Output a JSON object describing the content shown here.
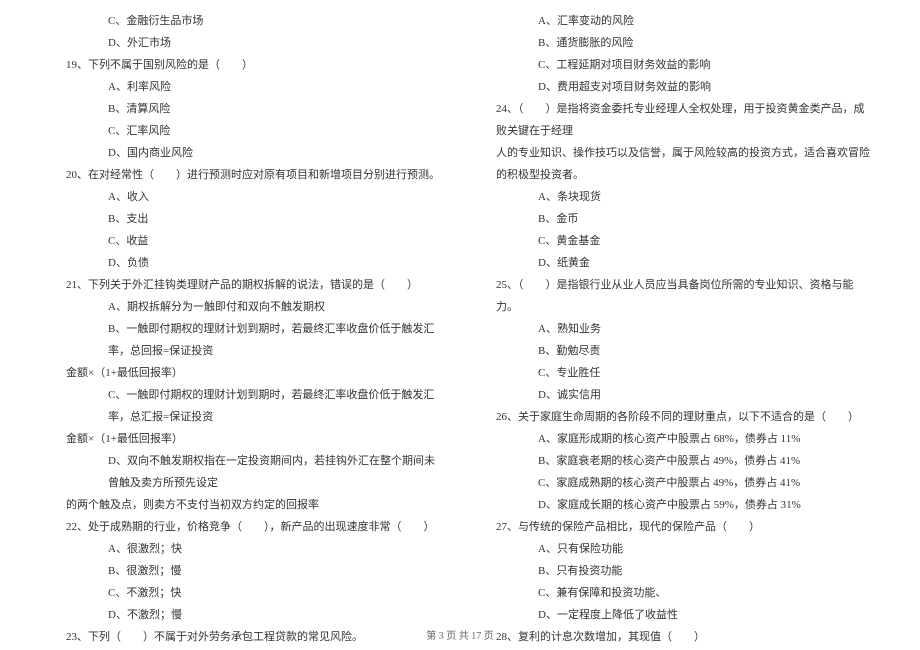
{
  "footer": "第 3 页  共 17 页",
  "left": {
    "pre_opts": [
      "C、金融衍生品市场",
      "D、外汇市场"
    ],
    "q19": {
      "text": "19、下列不属于国别风险的是（　　）",
      "opts": [
        "A、利率风险",
        "B、清算风险",
        "C、汇率风险",
        "D、国内商业风险"
      ]
    },
    "q20": {
      "text": "20、在对经常性（　　）进行预测时应对原有项目和新增项目分别进行预测。",
      "opts": [
        "A、收入",
        "B、支出",
        "C、收益",
        "D、负债"
      ]
    },
    "q21": {
      "text": "21、下列关于外汇挂钩类理财产品的期权拆解的说法，错误的是（　　）",
      "optA": "A、期权拆解分为一触即付和双向不触发期权",
      "optB1": "B、一触即付期权的理财计划到期时，若最终汇率收盘价低于触发汇率，总回报=保证投资",
      "optB2": "金额×（1+最低回报率）",
      "optC1": "C、一触即付期权的理财计划到期时，若最终汇率收盘价低于触发汇率，总汇报=保证投资",
      "optC2": "金额×（1+最低回报率）",
      "optD1": "D、双向不触发期权指在一定投资期间内，若挂钩外汇在整个期间未曾触及卖方所预先设定",
      "optD2": "的两个触及点，则卖方不支付当初双方约定的回报率"
    },
    "q22": {
      "text": "22、处于成熟期的行业，价格竞争（　　），新产品的出现速度非常（　　）",
      "opts": [
        "A、很激烈；快",
        "B、很激烈；慢",
        "C、不激烈；快",
        "D、不激烈；慢"
      ]
    },
    "q23": {
      "text": "23、下列（　　）不属于对外劳务承包工程贷款的常见风险。"
    }
  },
  "right": {
    "q23_opts": [
      "A、汇率变动的风险",
      "B、通货膨胀的风险",
      "C、工程延期对项目财务效益的影响",
      "D、费用超支对项目财务效益的影响"
    ],
    "q24": {
      "line1": "24、（　　）是指将资金委托专业经理人全权处理，用于投资黄金类产品，成败关键在于经理",
      "line2": "人的专业知识、操作技巧以及信誉，属于风险较高的投资方式，适合喜欢冒险的积极型投资者。",
      "opts": [
        "A、条块现货",
        "B、金币",
        "C、黄金基金",
        "D、纸黄金"
      ]
    },
    "q25": {
      "text": "25、（　　）是指银行业从业人员应当具备岗位所需的专业知识、资格与能力。",
      "opts": [
        "A、熟知业务",
        "B、勤勉尽责",
        "C、专业胜任",
        "D、诚实信用"
      ]
    },
    "q26": {
      "text": "26、关于家庭生命周期的各阶段不同的理财重点，以下不适合的是（　　）",
      "opts": [
        "A、家庭形成期的核心资产中股票占 68%，债券占 11%",
        "B、家庭衰老期的核心资产中股票占 49%，债券占 41%",
        "C、家庭成熟期的核心资产中股票占 49%，债券占 41%",
        "D、家庭成长期的核心资产中股票占 59%，债券占 31%"
      ]
    },
    "q27": {
      "text": "27、与传统的保险产品相比，现代的保险产品（　　）",
      "opts": [
        "A、只有保险功能",
        "B、只有投资功能",
        "C、兼有保障和投资功能、",
        "D、一定程度上降低了收益性"
      ]
    },
    "q28": {
      "text": "28、复利的计息次数增加，其现值（　　）"
    }
  }
}
